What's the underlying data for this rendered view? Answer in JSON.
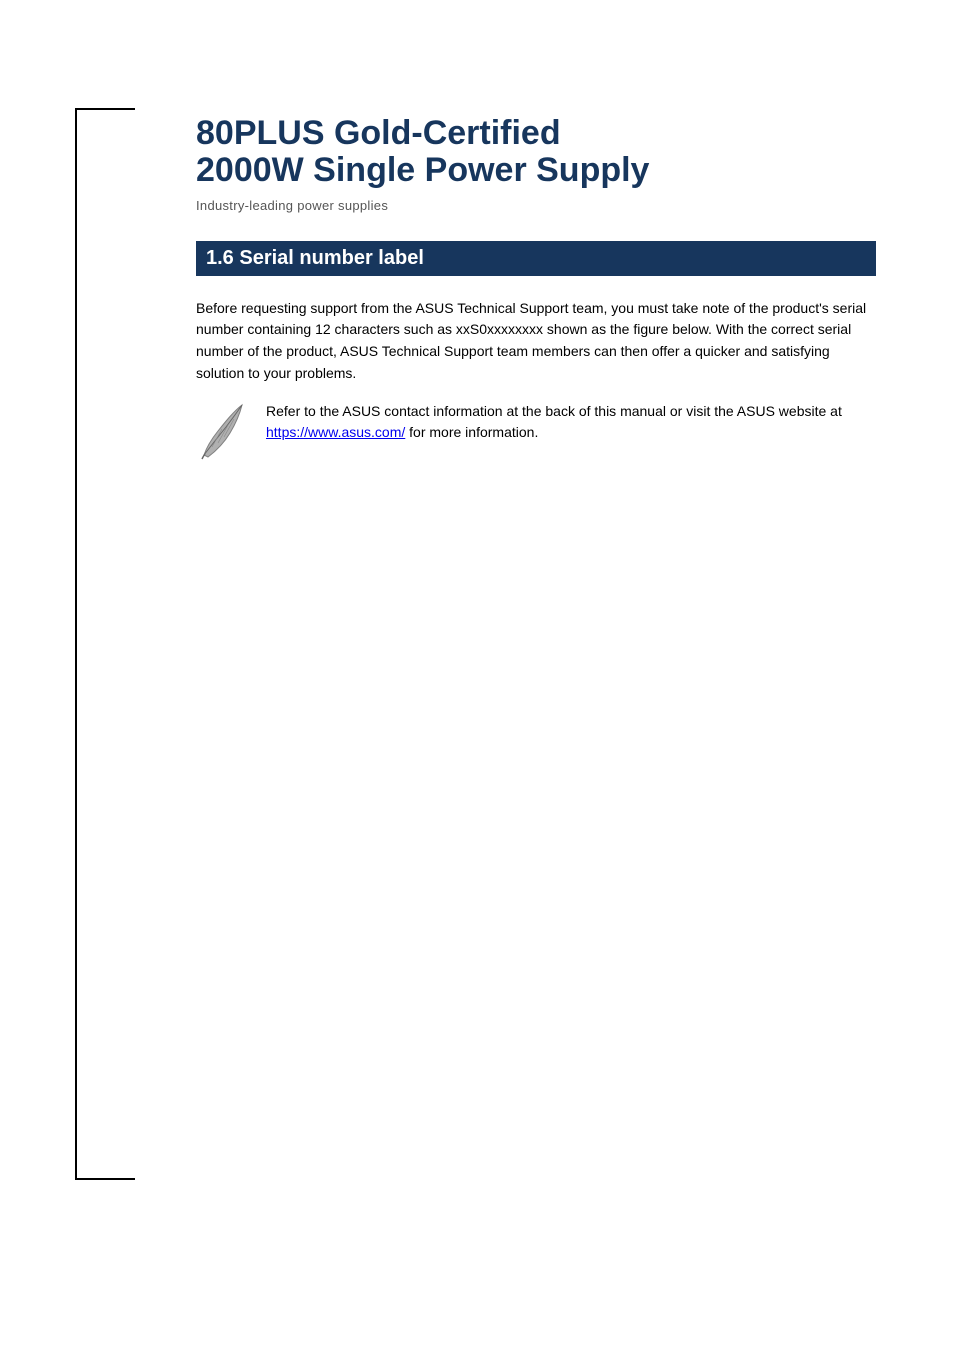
{
  "title": {
    "main_line1": "80PLUS Gold-Certified",
    "main_line2": "2000W Single Power Supply",
    "sub": "Industry-leading power supplies"
  },
  "section_heading": "1.6 Serial number label",
  "paragraphs": [
    "Before requesting support from the ASUS Technical Support team, you must take note of the product's serial number containing 12 characters such as xxS0xxxxxxxx shown as the figure below. With the correct serial number of the product, ASUS Technical Support team members can then offer a quicker and satisfying solution to your problems."
  ],
  "note": {
    "prefix": "Refer to the ASUS contact information at the back of this manual or visit the ASUS website at ",
    "link_text": "https://www.asus.com/",
    "link_href": "https://www.asus.com/",
    "suffix": " for more information."
  }
}
